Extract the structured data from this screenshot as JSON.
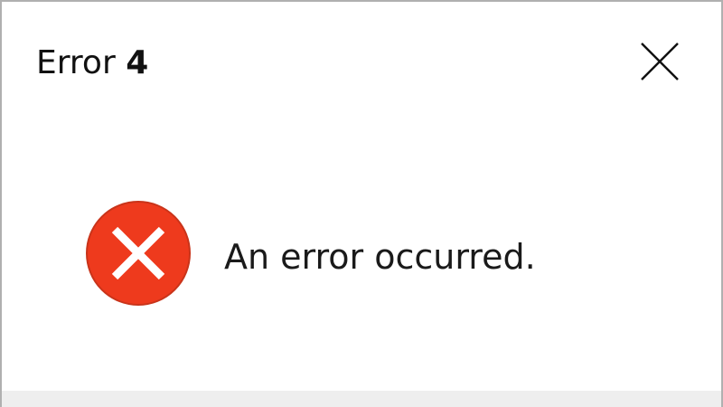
{
  "dialog": {
    "title_prefix": "Error",
    "error_code": "4",
    "close_icon": "close-icon",
    "message": "An error occurred.",
    "error_icon": "error-circle-x-icon",
    "colors": {
      "error_red": "#ee3a1d",
      "footer_bg": "#eeeeee",
      "border": "#b0b0b0"
    }
  }
}
